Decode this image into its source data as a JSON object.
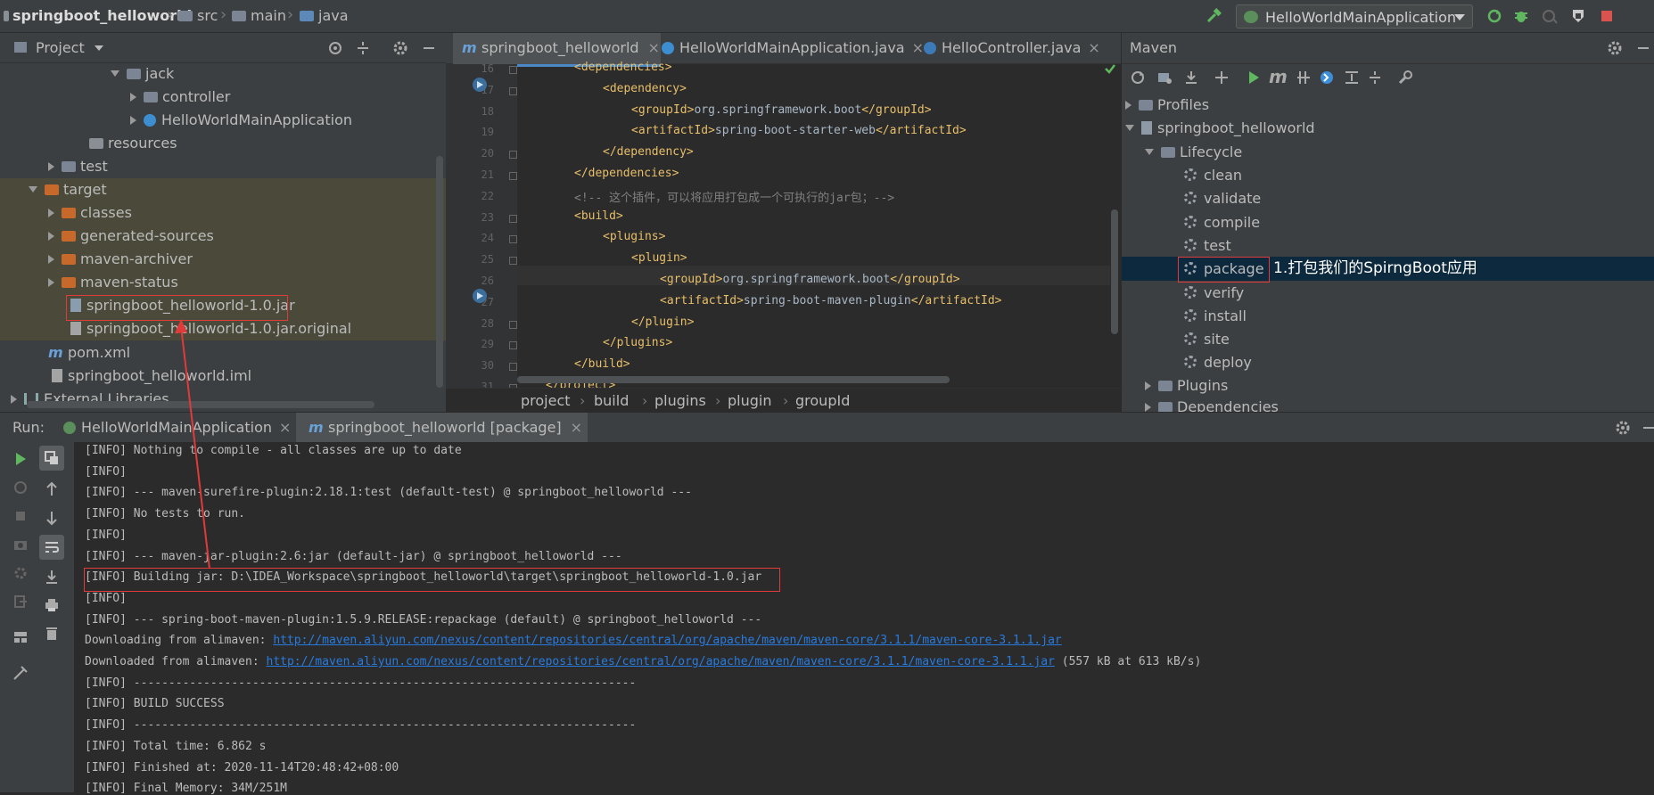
{
  "breadcrumb": [
    "springboot_helloworld",
    "src",
    "main",
    "java"
  ],
  "run_config": "HelloWorldMainApplication",
  "project_panel": {
    "title": "Project",
    "tree": [
      {
        "label": "jack",
        "kind": "folder"
      },
      {
        "label": "controller",
        "kind": "folder"
      },
      {
        "label": "HelloWorldMainApplication",
        "kind": "app"
      },
      {
        "label": "resources",
        "kind": "folder"
      },
      {
        "label": "test",
        "kind": "folder"
      },
      {
        "label": "target",
        "kind": "folder-orange"
      },
      {
        "label": "classes",
        "kind": "folder-orange"
      },
      {
        "label": "generated-sources",
        "kind": "folder-orange"
      },
      {
        "label": "maven-archiver",
        "kind": "folder-orange"
      },
      {
        "label": "maven-status",
        "kind": "folder-orange"
      },
      {
        "label": "springboot_helloworld-1.0.jar",
        "kind": "jar"
      },
      {
        "label": "springboot_helloworld-1.0.jar.original",
        "kind": "file"
      },
      {
        "label": "pom.xml",
        "kind": "maven"
      },
      {
        "label": "springboot_helloworld.iml",
        "kind": "file"
      },
      {
        "label": "External Libraries",
        "kind": "libs"
      }
    ]
  },
  "editor": {
    "tabs": [
      {
        "label": "springboot_helloworld"
      },
      {
        "label": "HelloWorldMainApplication.java"
      },
      {
        "label": "HelloController.java"
      }
    ],
    "lines": [
      {
        "n": "16",
        "indent": 1,
        "text": "<dependencies>"
      },
      {
        "n": "17",
        "indent": 2,
        "text": "<dependency>"
      },
      {
        "n": "18",
        "indent": 3,
        "tag": "groupId",
        "value": "org.springframework.boot"
      },
      {
        "n": "19",
        "indent": 3,
        "tag": "artifactId",
        "value": "spring-boot-starter-web"
      },
      {
        "n": "20",
        "indent": 2,
        "text": "</dependency>"
      },
      {
        "n": "21",
        "indent": 1,
        "text": "</dependencies>"
      },
      {
        "n": "22",
        "indent": 1,
        "comment": "<!-- 这个插件，可以将应用打包成一个可执行的jar包；-->"
      },
      {
        "n": "23",
        "indent": 1,
        "text": "<build>"
      },
      {
        "n": "24",
        "indent": 2,
        "text": "<plugins>"
      },
      {
        "n": "25",
        "indent": 3,
        "text": "<plugin>"
      },
      {
        "n": "26",
        "indent": 4,
        "tag": "groupId",
        "value": "org.springframework.boot"
      },
      {
        "n": "27",
        "indent": 4,
        "tag": "artifactId",
        "value": "spring-boot-maven-plugin"
      },
      {
        "n": "28",
        "indent": 3,
        "text": "</plugin>"
      },
      {
        "n": "29",
        "indent": 2,
        "text": "</plugins>"
      },
      {
        "n": "30",
        "indent": 1,
        "text": "</build>"
      },
      {
        "n": "31",
        "indent": 0,
        "text": "</project>"
      }
    ],
    "breadcrumb": [
      "project",
      "build",
      "plugins",
      "plugin",
      "groupId"
    ]
  },
  "maven_panel": {
    "title": "Maven",
    "profiles": "Profiles",
    "project": "springboot_helloworld",
    "lifecycle": "Lifecycle",
    "goals": [
      "clean",
      "validate",
      "compile",
      "test",
      "package",
      "verify",
      "install",
      "site",
      "deploy"
    ],
    "plugins": "Plugins",
    "dependencies": "Dependencies",
    "annotation": "1.打包我们的SpirngBoot应用"
  },
  "run_panel": {
    "label": "Run:",
    "tabs": [
      "HelloWorldMainApplication",
      "springboot_helloworld [package]"
    ],
    "console": [
      {
        "text": "[INFO] Nothing to compile - all classes are up to date"
      },
      {
        "text": "[INFO]"
      },
      {
        "text": "[INFO] --- maven-surefire-plugin:2.18.1:test (default-test) @ springboot_helloworld ---"
      },
      {
        "text": "[INFO] No tests to run."
      },
      {
        "text": "[INFO]"
      },
      {
        "text": "[INFO] --- maven-jar-plugin:2.6:jar (default-jar) @ springboot_helloworld ---"
      },
      {
        "text": "[INFO] Building jar: D:\\IDEA_Workspace\\springboot_helloworld\\target\\springboot_helloworld-1.0.jar"
      },
      {
        "text": "[INFO]"
      },
      {
        "text": "[INFO] --- spring-boot-maven-plugin:1.5.9.RELEASE:repackage (default) @ springboot_helloworld ---"
      },
      {
        "text": "Downloading from alimaven: ",
        "link": "http://maven.aliyun.com/nexus/content/repositories/central/org/apache/maven/maven-core/3.1.1/maven-core-3.1.1.jar"
      },
      {
        "text": "Downloaded from alimaven: ",
        "link": "http://maven.aliyun.com/nexus/content/repositories/central/org/apache/maven/maven-core/3.1.1/maven-core-3.1.1.jar",
        "suffix": " (557 kB at 613 kB/s)"
      },
      {
        "text": "[INFO] ------------------------------------------------------------------------"
      },
      {
        "text": "[INFO] BUILD SUCCESS"
      },
      {
        "text": "[INFO] ------------------------------------------------------------------------"
      },
      {
        "text": "[INFO] Total time: 6.862 s"
      },
      {
        "text": "[INFO] Finished at: 2020-11-14T20:48:42+08:00"
      },
      {
        "text": "[INFO] Final Memory: 34M/251M"
      }
    ]
  },
  "colors": {
    "accent": "#4a88c7",
    "highlight_red": "#e03a3a",
    "selected_row": "#0d293e"
  }
}
